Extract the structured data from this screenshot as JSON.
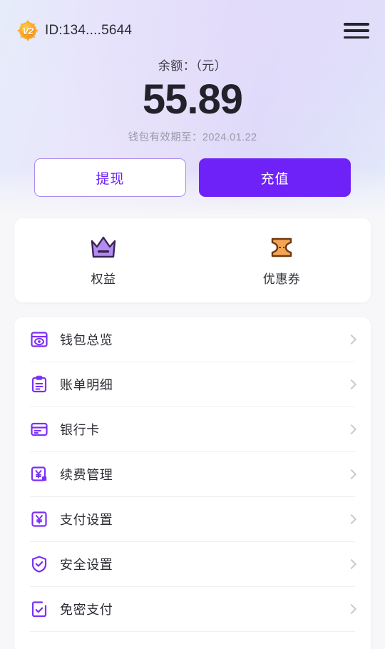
{
  "header": {
    "badge_text": "V2",
    "badge_icon": "vip-level-badge-icon",
    "user_id": "ID:134....5644",
    "menu_icon": "hamburger-menu-icon"
  },
  "balance": {
    "label": "余额：（元）",
    "amount": "55.89",
    "expiry": "钱包有效期至：2024.01.22"
  },
  "actions": {
    "withdraw_label": "提现",
    "recharge_label": "充值"
  },
  "quick_actions": [
    {
      "label": "权益",
      "icon": "crown-icon"
    },
    {
      "label": "优惠券",
      "icon": "coupon-ticket-icon"
    }
  ],
  "menu": [
    {
      "label": "钱包总览",
      "icon": "wallet-overview-icon"
    },
    {
      "label": "账单明细",
      "icon": "bill-details-icon"
    },
    {
      "label": "银行卡",
      "icon": "bank-card-icon"
    },
    {
      "label": "续费管理",
      "icon": "renewal-management-icon"
    },
    {
      "label": "支付设置",
      "icon": "payment-settings-icon"
    },
    {
      "label": "安全设置",
      "icon": "security-shield-icon"
    },
    {
      "label": "免密支付",
      "icon": "password-free-payment-icon"
    }
  ],
  "colors": {
    "accent_purple": "#6e22f7",
    "icon_purple": "#7b2ff7",
    "coupon_orange": "#f5a04a",
    "crown_purple": "#b48cf0",
    "badge_gold": "#ffa827",
    "text_primary": "#22222a",
    "text_muted": "#9a9aa8"
  }
}
